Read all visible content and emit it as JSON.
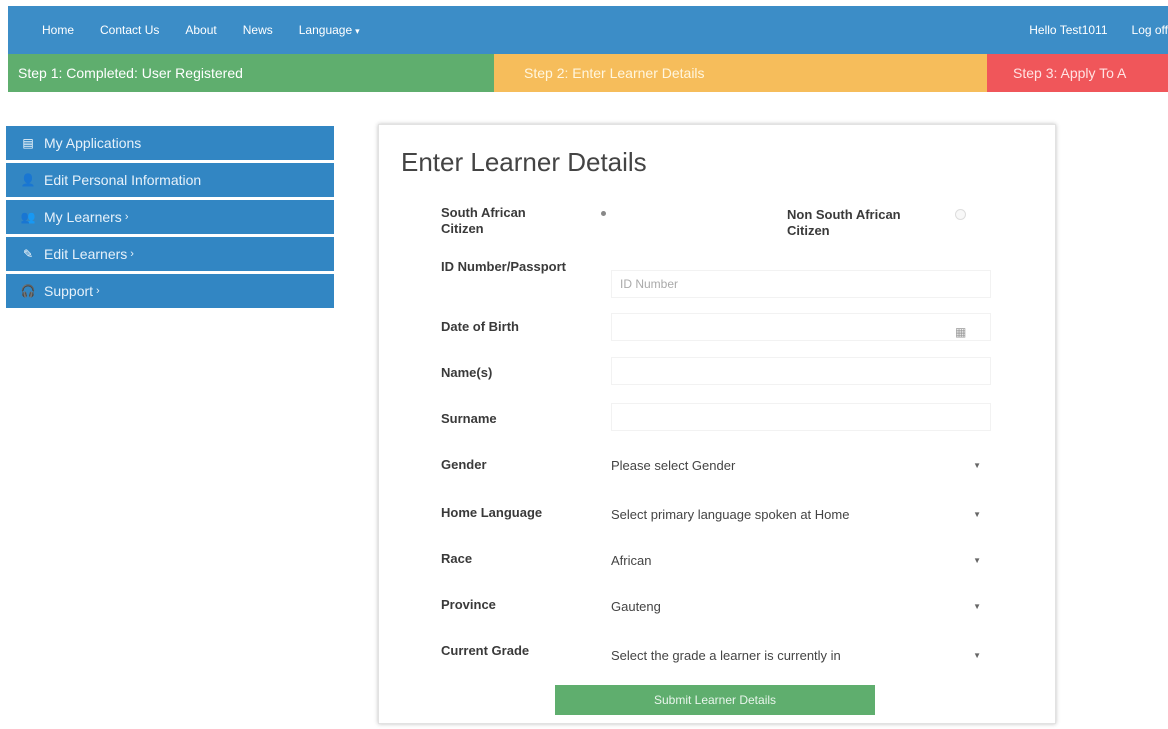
{
  "nav": {
    "home": "Home",
    "contact": "Contact Us",
    "about": "About",
    "news": "News",
    "language": "Language",
    "hello": "Hello Test1011",
    "logoff": "Log off"
  },
  "steps": {
    "step1": "Step 1: Completed: User Registered",
    "step2": "Step 2: Enter Learner Details",
    "step3": "Step 3: Apply To A"
  },
  "sidebar": {
    "items": [
      {
        "label": "My Applications",
        "icon": "list-icon"
      },
      {
        "label": "Edit Personal Information",
        "icon": "user-icon"
      },
      {
        "label": "My Learners",
        "icon": "users-icon"
      },
      {
        "label": "Edit Learners",
        "icon": "pencil-icon"
      },
      {
        "label": "Support",
        "icon": "headset-icon"
      }
    ]
  },
  "form": {
    "title": "Enter Learner Details",
    "sa_citizen": "South African Citizen",
    "non_sa_citizen": "Non South African Citizen",
    "id_label": "ID Number/Passport",
    "id_placeholder": "ID Number",
    "dob_label": "Date of Birth",
    "names_label": "Name(s)",
    "surname_label": "Surname",
    "gender_label": "Gender",
    "gender_value": "Please select Gender",
    "home_language_label": "Home Language",
    "home_language_value": "Select primary language spoken at Home",
    "race_label": "Race",
    "race_value": "African",
    "province_label": "Province",
    "province_value": "Gauteng",
    "grade_label": "Current Grade",
    "grade_value": "Select the grade a learner is currently in",
    "submit": "Submit Learner Details"
  },
  "colors": {
    "nav": "#3c8dc7",
    "step_done": "#5fae6e",
    "step_current": "#f6bd5b",
    "step_next": "#f0565a",
    "sidebar": "#3286c3"
  }
}
